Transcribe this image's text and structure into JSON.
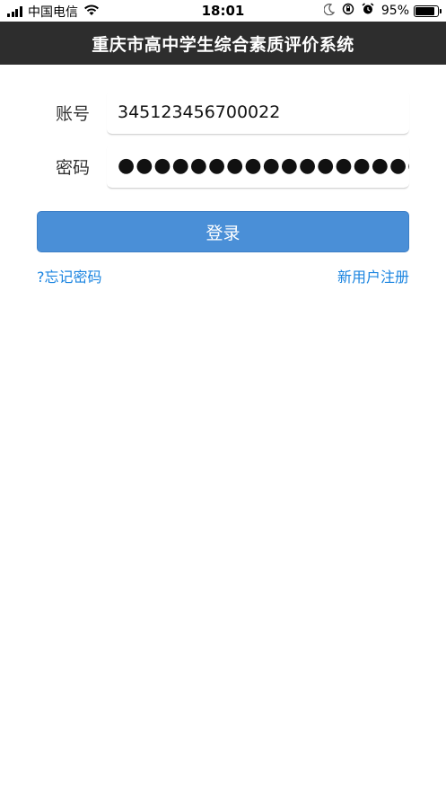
{
  "status_bar": {
    "carrier": "中国电信",
    "time": "18:01",
    "battery": "95%",
    "battery_level": 0.95,
    "icons": [
      "signal-icon",
      "wifi-icon",
      "moon-icon",
      "orientation-lock-icon",
      "alarm-icon",
      "battery-icon"
    ]
  },
  "header": {
    "title": "重庆市高中学生综合素质评价系统",
    "background": "#2d2d2d"
  },
  "form": {
    "account_label": "账号",
    "account_value": "345123456700022",
    "password_label": "密码",
    "password_value": "●●●●●●●●●●●●●●●●●●●"
  },
  "actions": {
    "login_label": "登录",
    "login_color": "#4a8fd7",
    "forgot_label": "?忘记密码",
    "register_label": "新用户注册",
    "link_color": "#1a84e0"
  }
}
